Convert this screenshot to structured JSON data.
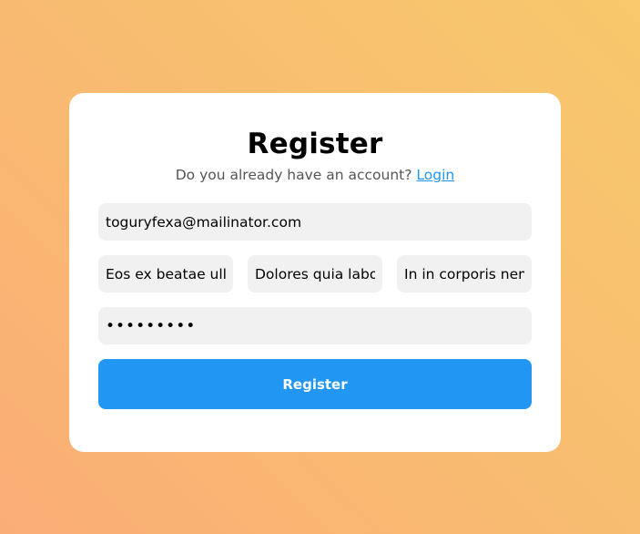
{
  "form": {
    "title": "Register",
    "subtitle_text": "Do you already have an account?",
    "login_link": "Login",
    "email_value": "toguryfexa@mailinator.com",
    "field1_value": "Eos ex beatae ullam",
    "field2_value": "Dolores quia laborum",
    "field3_value": "In in corporis nemo",
    "password_value": "123456789",
    "submit_label": "Register"
  },
  "colors": {
    "accent": "#2196f3",
    "field_background": "#f1f1f1",
    "card_background": "#ffffff",
    "gradient_start": "#fbad76",
    "gradient_end": "#f7c86c"
  }
}
